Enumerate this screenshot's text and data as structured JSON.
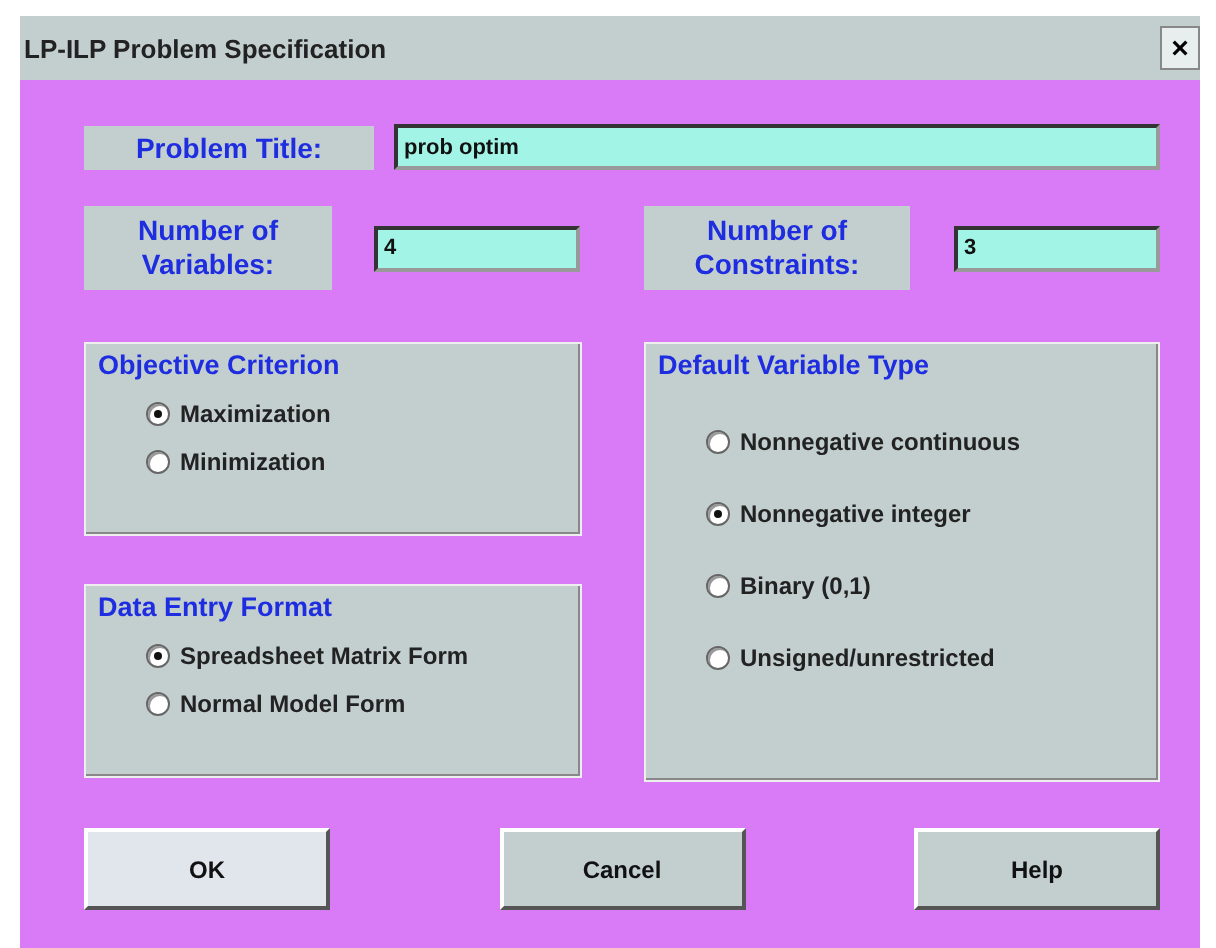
{
  "window": {
    "title": "LP-ILP Problem Specification",
    "close": "×"
  },
  "problem_title": {
    "label": "Problem Title:",
    "value": "prob optim"
  },
  "num_variables": {
    "label": "Number of Variables:",
    "value": "4"
  },
  "num_constraints": {
    "label": "Number of Constraints:",
    "value": "3"
  },
  "objective_criterion": {
    "title": "Objective Criterion",
    "options": [
      {
        "label": "Maximization",
        "selected": true
      },
      {
        "label": "Minimization",
        "selected": false
      }
    ]
  },
  "data_entry_format": {
    "title": "Data Entry Format",
    "options": [
      {
        "label": "Spreadsheet Matrix Form",
        "selected": true
      },
      {
        "label": "Normal Model Form",
        "selected": false
      }
    ]
  },
  "default_variable_type": {
    "title": "Default Variable Type",
    "options": [
      {
        "label": "Nonnegative continuous",
        "selected": false
      },
      {
        "label": "Nonnegative integer",
        "selected": true
      },
      {
        "label": "Binary (0,1)",
        "selected": false
      },
      {
        "label": "Unsigned/unrestricted",
        "selected": false
      }
    ]
  },
  "buttons": [
    {
      "label": "OK",
      "focused": true
    },
    {
      "label": "Cancel",
      "focused": false
    },
    {
      "label": "Help",
      "focused": false
    }
  ]
}
